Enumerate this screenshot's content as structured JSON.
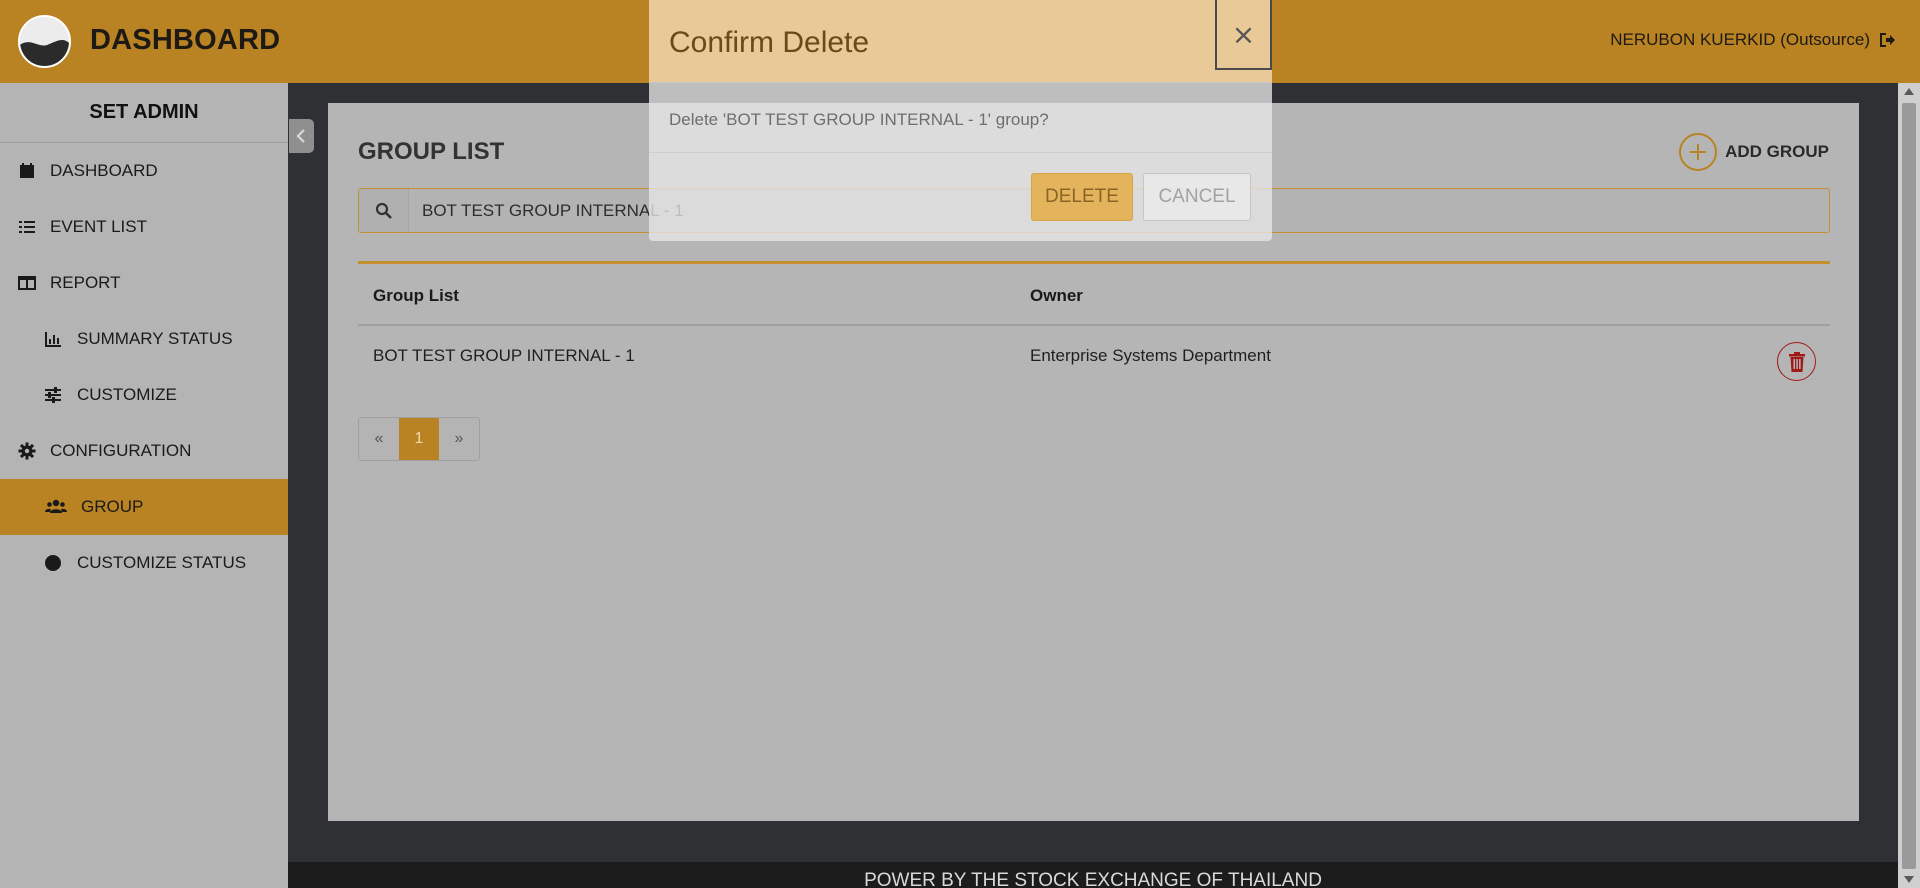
{
  "header": {
    "brand": "DASHBOARD",
    "user": "NERUBON KUERKID (Outsource)"
  },
  "sidebar": {
    "title": "SET ADMIN",
    "items": [
      {
        "label": "DASHBOARD",
        "icon": "calendar-icon"
      },
      {
        "label": "EVENT LIST",
        "icon": "list-icon"
      },
      {
        "label": "REPORT",
        "icon": "table-icon"
      },
      {
        "label": "SUMMARY STATUS",
        "icon": "bar-chart-icon"
      },
      {
        "label": "CUSTOMIZE",
        "icon": "sliders-icon"
      },
      {
        "label": "CONFIGURATION",
        "icon": "gear-icon"
      },
      {
        "label": "GROUP",
        "icon": "users-icon"
      },
      {
        "label": "CUSTOMIZE STATUS",
        "icon": "circle-icon"
      }
    ]
  },
  "main": {
    "title": "GROUP LIST",
    "add_label": "ADD GROUP",
    "search": {
      "value": "BOT TEST GROUP INTERNAL - 1"
    },
    "table": {
      "columns": [
        "Group List",
        "Owner"
      ],
      "rows": [
        {
          "group": "BOT TEST GROUP INTERNAL - 1",
          "owner": "Enterprise Systems Department"
        }
      ]
    },
    "pagination": {
      "prev": "«",
      "current": "1",
      "next": "»"
    }
  },
  "footer": "POWER BY THE STOCK EXCHANGE OF THAILAND",
  "modal": {
    "title": "Confirm Delete",
    "close": "×",
    "message": "Delete 'BOT TEST GROUP INTERNAL - 1' group?",
    "delete_label": "DELETE",
    "cancel_label": "CANCEL"
  },
  "colors": {
    "accent": "#b98222",
    "danger": "#a11a1a"
  }
}
